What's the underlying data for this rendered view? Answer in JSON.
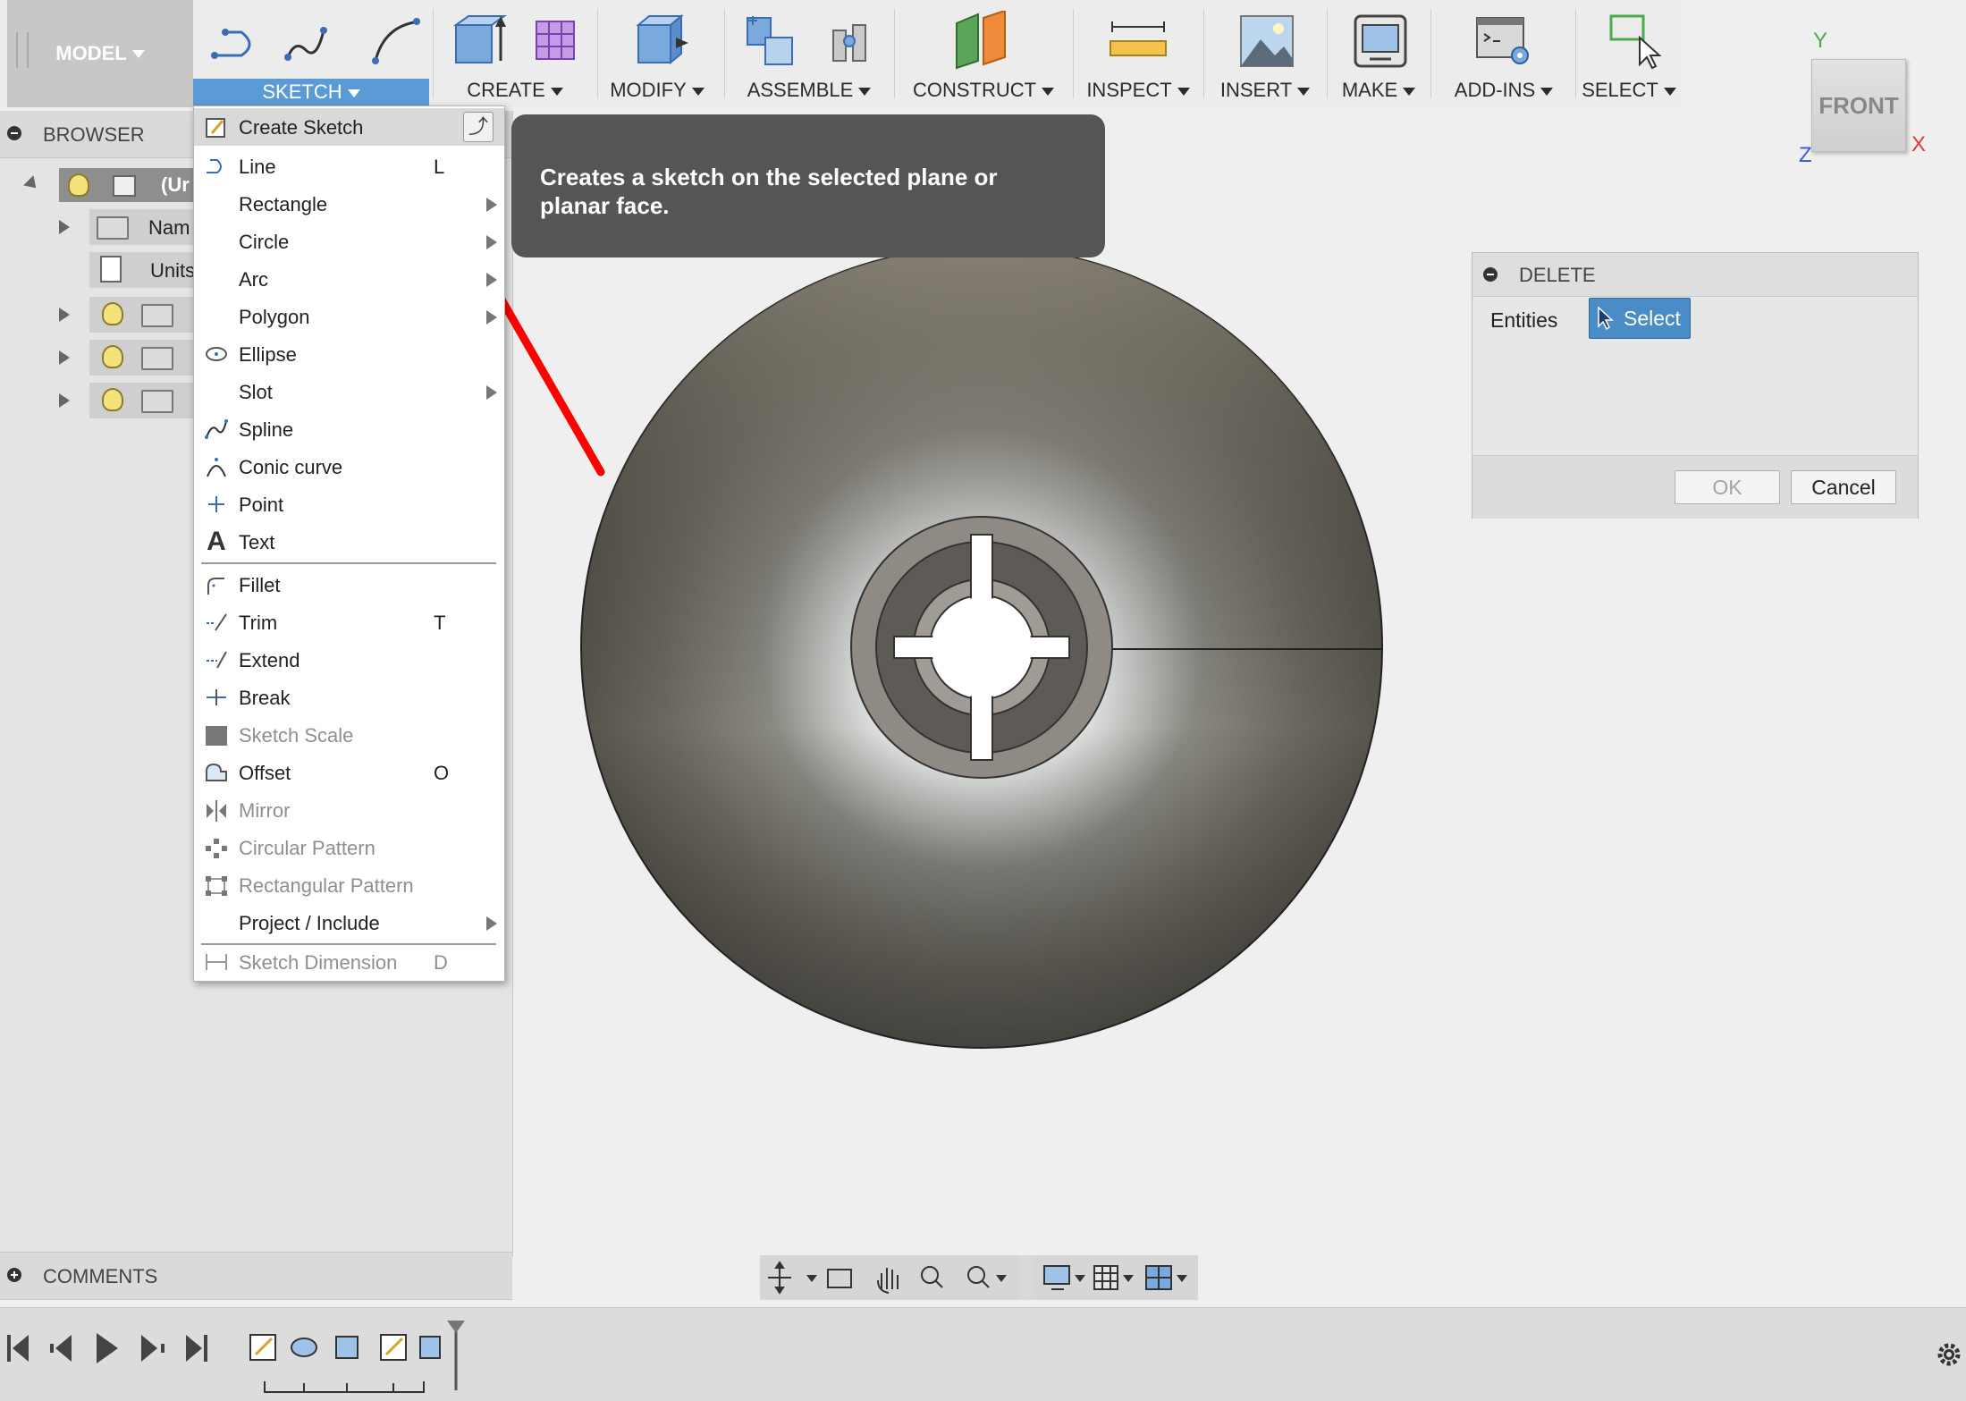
{
  "toolbar": {
    "model_label": "MODEL",
    "groups": [
      {
        "label": "SKETCH",
        "active": true
      },
      {
        "label": "CREATE"
      },
      {
        "label": "MODIFY"
      },
      {
        "label": "ASSEMBLE"
      },
      {
        "label": "CONSTRUCT"
      },
      {
        "label": "INSPECT"
      },
      {
        "label": "INSERT"
      },
      {
        "label": "MAKE"
      },
      {
        "label": "ADD-INS"
      },
      {
        "label": "SELECT"
      }
    ]
  },
  "browser": {
    "title": "BROWSER",
    "items": [
      {
        "label": "(Ur"
      },
      {
        "label": "Nam"
      },
      {
        "label": "Units"
      }
    ]
  },
  "comments": {
    "title": "COMMENTS"
  },
  "sketch_menu": {
    "items": [
      {
        "label": "Create Sketch",
        "shortcut": "",
        "icon": "create-sketch-icon"
      },
      {
        "label": "Line",
        "shortcut": "L",
        "icon": "line-icon"
      },
      {
        "label": "Rectangle",
        "submenu": true
      },
      {
        "label": "Circle",
        "submenu": true
      },
      {
        "label": "Arc",
        "submenu": true
      },
      {
        "label": "Polygon",
        "submenu": true
      },
      {
        "label": "Ellipse",
        "icon": "ellipse-icon"
      },
      {
        "label": "Slot",
        "submenu": true
      },
      {
        "label": "Spline",
        "icon": "spline-icon"
      },
      {
        "label": "Conic curve",
        "icon": "conic-curve-icon"
      },
      {
        "label": "Point",
        "icon": "point-icon"
      },
      {
        "label": "Text",
        "icon": "text-icon"
      },
      {
        "label": "Fillet",
        "icon": "fillet-icon"
      },
      {
        "label": "Trim",
        "shortcut": "T",
        "icon": "trim-icon"
      },
      {
        "label": "Extend",
        "icon": "extend-icon"
      },
      {
        "label": "Break",
        "icon": "break-icon"
      },
      {
        "label": "Sketch Scale",
        "disabled": true,
        "icon": "sketch-scale-icon"
      },
      {
        "label": "Offset",
        "shortcut": "O",
        "icon": "offset-icon"
      },
      {
        "label": "Mirror",
        "disabled": true,
        "icon": "mirror-icon"
      },
      {
        "label": "Circular Pattern",
        "disabled": true,
        "icon": "circular-pattern-icon"
      },
      {
        "label": "Rectangular Pattern",
        "disabled": true,
        "icon": "rectangular-pattern-icon"
      },
      {
        "label": "Project / Include",
        "submenu": true
      },
      {
        "label": "Sketch Dimension",
        "shortcut": "D",
        "disabled": true,
        "icon": "sketch-dimension-icon"
      }
    ]
  },
  "tooltip": {
    "text": "Creates a sketch on the selected plane or planar face."
  },
  "delete_dialog": {
    "title": "DELETE",
    "entities_label": "Entities",
    "select_label": "Select",
    "ok_label": "OK",
    "cancel_label": "Cancel"
  },
  "viewcube": {
    "face_label": "FRONT",
    "axis_y": "Y",
    "axis_x": "X",
    "axis_z": "Z"
  },
  "colors": {
    "accent": "#5b9bd5",
    "arrow": "#ff0000",
    "tooltip_bg": "#555555"
  }
}
